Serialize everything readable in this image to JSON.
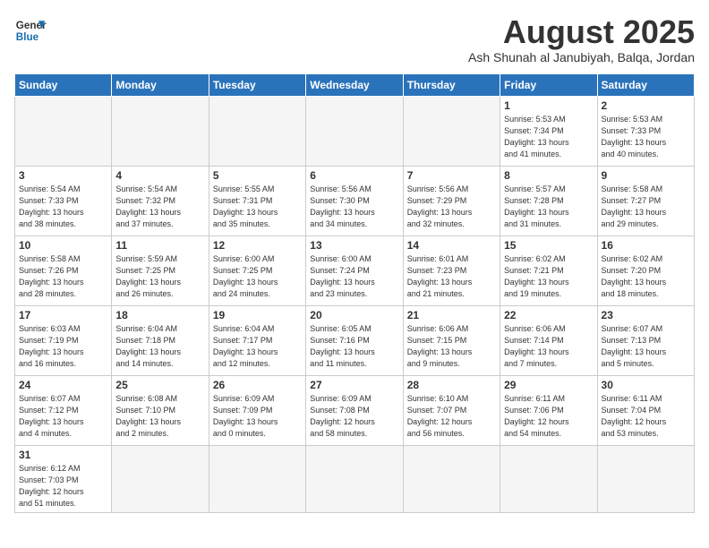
{
  "logo": {
    "line1": "General",
    "line2": "Blue"
  },
  "title": "August 2025",
  "subtitle": "Ash Shunah al Janubiyah, Balqa, Jordan",
  "headers": [
    "Sunday",
    "Monday",
    "Tuesday",
    "Wednesday",
    "Thursday",
    "Friday",
    "Saturday"
  ],
  "weeks": [
    [
      {
        "day": "",
        "info": ""
      },
      {
        "day": "",
        "info": ""
      },
      {
        "day": "",
        "info": ""
      },
      {
        "day": "",
        "info": ""
      },
      {
        "day": "",
        "info": ""
      },
      {
        "day": "1",
        "info": "Sunrise: 5:53 AM\nSunset: 7:34 PM\nDaylight: 13 hours\nand 41 minutes."
      },
      {
        "day": "2",
        "info": "Sunrise: 5:53 AM\nSunset: 7:33 PM\nDaylight: 13 hours\nand 40 minutes."
      }
    ],
    [
      {
        "day": "3",
        "info": "Sunrise: 5:54 AM\nSunset: 7:33 PM\nDaylight: 13 hours\nand 38 minutes."
      },
      {
        "day": "4",
        "info": "Sunrise: 5:54 AM\nSunset: 7:32 PM\nDaylight: 13 hours\nand 37 minutes."
      },
      {
        "day": "5",
        "info": "Sunrise: 5:55 AM\nSunset: 7:31 PM\nDaylight: 13 hours\nand 35 minutes."
      },
      {
        "day": "6",
        "info": "Sunrise: 5:56 AM\nSunset: 7:30 PM\nDaylight: 13 hours\nand 34 minutes."
      },
      {
        "day": "7",
        "info": "Sunrise: 5:56 AM\nSunset: 7:29 PM\nDaylight: 13 hours\nand 32 minutes."
      },
      {
        "day": "8",
        "info": "Sunrise: 5:57 AM\nSunset: 7:28 PM\nDaylight: 13 hours\nand 31 minutes."
      },
      {
        "day": "9",
        "info": "Sunrise: 5:58 AM\nSunset: 7:27 PM\nDaylight: 13 hours\nand 29 minutes."
      }
    ],
    [
      {
        "day": "10",
        "info": "Sunrise: 5:58 AM\nSunset: 7:26 PM\nDaylight: 13 hours\nand 28 minutes."
      },
      {
        "day": "11",
        "info": "Sunrise: 5:59 AM\nSunset: 7:25 PM\nDaylight: 13 hours\nand 26 minutes."
      },
      {
        "day": "12",
        "info": "Sunrise: 6:00 AM\nSunset: 7:25 PM\nDaylight: 13 hours\nand 24 minutes."
      },
      {
        "day": "13",
        "info": "Sunrise: 6:00 AM\nSunset: 7:24 PM\nDaylight: 13 hours\nand 23 minutes."
      },
      {
        "day": "14",
        "info": "Sunrise: 6:01 AM\nSunset: 7:23 PM\nDaylight: 13 hours\nand 21 minutes."
      },
      {
        "day": "15",
        "info": "Sunrise: 6:02 AM\nSunset: 7:21 PM\nDaylight: 13 hours\nand 19 minutes."
      },
      {
        "day": "16",
        "info": "Sunrise: 6:02 AM\nSunset: 7:20 PM\nDaylight: 13 hours\nand 18 minutes."
      }
    ],
    [
      {
        "day": "17",
        "info": "Sunrise: 6:03 AM\nSunset: 7:19 PM\nDaylight: 13 hours\nand 16 minutes."
      },
      {
        "day": "18",
        "info": "Sunrise: 6:04 AM\nSunset: 7:18 PM\nDaylight: 13 hours\nand 14 minutes."
      },
      {
        "day": "19",
        "info": "Sunrise: 6:04 AM\nSunset: 7:17 PM\nDaylight: 13 hours\nand 12 minutes."
      },
      {
        "day": "20",
        "info": "Sunrise: 6:05 AM\nSunset: 7:16 PM\nDaylight: 13 hours\nand 11 minutes."
      },
      {
        "day": "21",
        "info": "Sunrise: 6:06 AM\nSunset: 7:15 PM\nDaylight: 13 hours\nand 9 minutes."
      },
      {
        "day": "22",
        "info": "Sunrise: 6:06 AM\nSunset: 7:14 PM\nDaylight: 13 hours\nand 7 minutes."
      },
      {
        "day": "23",
        "info": "Sunrise: 6:07 AM\nSunset: 7:13 PM\nDaylight: 13 hours\nand 5 minutes."
      }
    ],
    [
      {
        "day": "24",
        "info": "Sunrise: 6:07 AM\nSunset: 7:12 PM\nDaylight: 13 hours\nand 4 minutes."
      },
      {
        "day": "25",
        "info": "Sunrise: 6:08 AM\nSunset: 7:10 PM\nDaylight: 13 hours\nand 2 minutes."
      },
      {
        "day": "26",
        "info": "Sunrise: 6:09 AM\nSunset: 7:09 PM\nDaylight: 13 hours\nand 0 minutes."
      },
      {
        "day": "27",
        "info": "Sunrise: 6:09 AM\nSunset: 7:08 PM\nDaylight: 12 hours\nand 58 minutes."
      },
      {
        "day": "28",
        "info": "Sunrise: 6:10 AM\nSunset: 7:07 PM\nDaylight: 12 hours\nand 56 minutes."
      },
      {
        "day": "29",
        "info": "Sunrise: 6:11 AM\nSunset: 7:06 PM\nDaylight: 12 hours\nand 54 minutes."
      },
      {
        "day": "30",
        "info": "Sunrise: 6:11 AM\nSunset: 7:04 PM\nDaylight: 12 hours\nand 53 minutes."
      }
    ],
    [
      {
        "day": "31",
        "info": "Sunrise: 6:12 AM\nSunset: 7:03 PM\nDaylight: 12 hours\nand 51 minutes."
      },
      {
        "day": "",
        "info": ""
      },
      {
        "day": "",
        "info": ""
      },
      {
        "day": "",
        "info": ""
      },
      {
        "day": "",
        "info": ""
      },
      {
        "day": "",
        "info": ""
      },
      {
        "day": "",
        "info": ""
      }
    ]
  ]
}
